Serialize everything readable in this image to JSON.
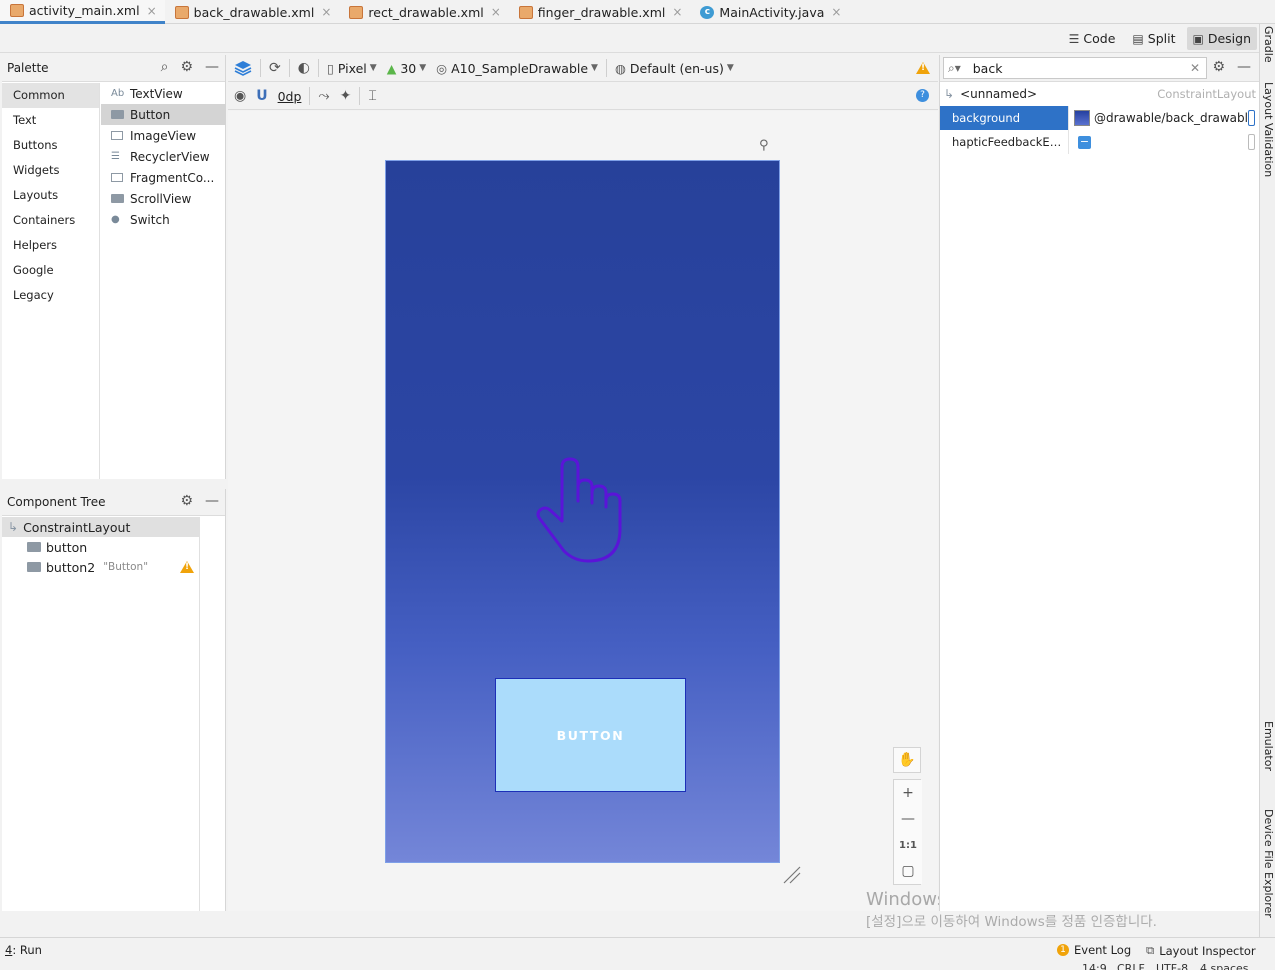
{
  "tabs": [
    {
      "label": "activity_main.xml",
      "type": "xml",
      "active": true
    },
    {
      "label": "back_drawable.xml",
      "type": "xml",
      "active": false
    },
    {
      "label": "rect_drawable.xml",
      "type": "xml",
      "active": false
    },
    {
      "label": "finger_drawable.xml",
      "type": "xml",
      "active": false
    },
    {
      "label": "MainActivity.java",
      "type": "java",
      "active": false
    }
  ],
  "tab_close": "×",
  "view_modes": {
    "code": "Code",
    "split": "Split",
    "design": "Design"
  },
  "right_strip": {
    "gradle": "Gradle",
    "layout_validation": "Layout Validation",
    "emulator": "Emulator",
    "device_file_explorer": "Device File Explorer"
  },
  "palette": {
    "title": "Palette",
    "categories": [
      "Common",
      "Text",
      "Buttons",
      "Widgets",
      "Layouts",
      "Containers",
      "Helpers",
      "Google",
      "Legacy"
    ],
    "items": [
      {
        "label": "TextView",
        "icon": "Ab"
      },
      {
        "label": "Button"
      },
      {
        "label": "ImageView"
      },
      {
        "label": "RecyclerView"
      },
      {
        "label": "FragmentCo..."
      },
      {
        "label": "ScrollView"
      },
      {
        "label": "Switch"
      }
    ]
  },
  "component_tree": {
    "title": "Component Tree",
    "root": "ConstraintLayout",
    "children": [
      {
        "label": "button",
        "sub": ""
      },
      {
        "label": "button2",
        "sub": "\"Button\""
      }
    ]
  },
  "design_toolbar": {
    "device": "Pixel",
    "api": "30",
    "theme": "A10_SampleDrawable",
    "locale": "Default (en-us)",
    "margin": "0dp"
  },
  "canvas": {
    "button_label": "BUTTON",
    "colors": {
      "gradient_top": "#27419a",
      "gradient_bottom": "#7486d8",
      "button_fill": "#abdcfb",
      "finger_stroke": "#5a14d8"
    }
  },
  "zoom": {
    "one_to_one": "1:1"
  },
  "attributes": {
    "search_value": "back",
    "element_id": "<unnamed>",
    "element_type": "ConstraintLayout",
    "rows": [
      {
        "key": "background",
        "value": "@drawable/back_drawable"
      },
      {
        "key": "hapticFeedbackEnabl...",
        "value": ""
      }
    ]
  },
  "watermark": {
    "line1": "Windows 정품 인증",
    "line2": "[설정]으로 이동하여 Windows를 정품 인증합니다."
  },
  "bottom_bar": {
    "run_key": "4",
    "run_label": ": Run",
    "event_log_count": "1",
    "event_log": "Event Log",
    "layout_inspector": "Layout Inspector",
    "status": [
      "14:9",
      "CRLF",
      "UTF-8",
      "4 spaces"
    ]
  }
}
